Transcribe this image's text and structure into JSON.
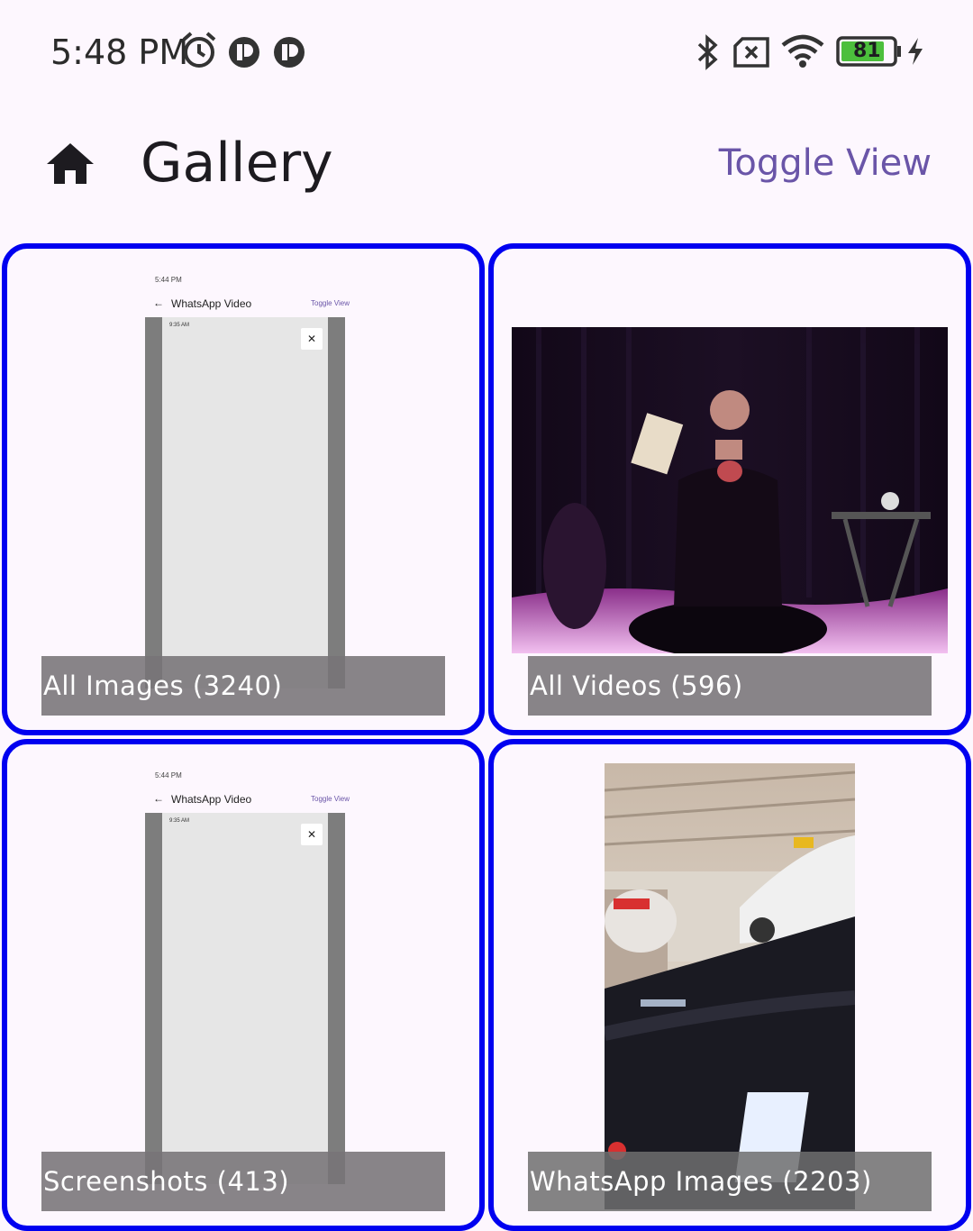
{
  "status_bar": {
    "time": "5:48 PM",
    "battery_level": "81",
    "icons": [
      "alarm-icon",
      "app-notification-icon",
      "app-notification-icon",
      "bluetooth-icon",
      "sim-error-icon",
      "wifi-icon",
      "battery-icon",
      "charging-icon"
    ],
    "battery_color": "#4cbf3c"
  },
  "app_bar": {
    "title": "Gallery",
    "toggle_label": "Toggle View",
    "accent_color": "#6a55a8"
  },
  "albums": [
    {
      "label": "All Images (3240)",
      "thumb": {
        "time": "5:44 PM",
        "title": "WhatsApp Video",
        "toggle": "Toggle View",
        "inner_time": "9:35 AM"
      }
    },
    {
      "label": "All Videos (596)"
    },
    {
      "label": "Screenshots (413)",
      "thumb": {
        "time": "5:44 PM",
        "title": "WhatsApp Video",
        "toggle": "Toggle View",
        "inner_time": "9:35 AM"
      }
    },
    {
      "label": "WhatsApp Images (2203)"
    }
  ],
  "card_border_color": "#0000f0"
}
